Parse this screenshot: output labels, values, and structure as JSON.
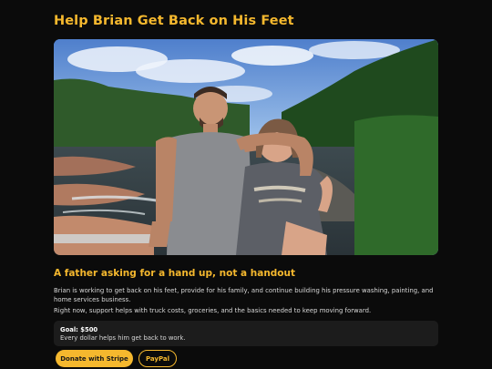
{
  "page": {
    "title": "Help Brian Get Back on His Feet",
    "hero_image": {
      "icon": "photo-of-brian-and-daughter",
      "alt": ""
    },
    "subhead": "A father asking for a hand up, not a handout",
    "paragraphs": [
      "Brian is working to get back on his feet, provide for his family, and continue building his pressure washing, painting, and home services business.",
      "Right now, support helps with truck costs, groceries, and the basics needed to keep moving forward."
    ],
    "goal": {
      "label": "Goal: $500",
      "description": "Every dollar helps him get back to work."
    },
    "buttons": {
      "stripe": "Donate with Stripe",
      "paypal": "PayPal"
    }
  },
  "colors": {
    "background": "#0b0b0b",
    "accent": "#f5b82e",
    "card": "#1c1c1c"
  }
}
